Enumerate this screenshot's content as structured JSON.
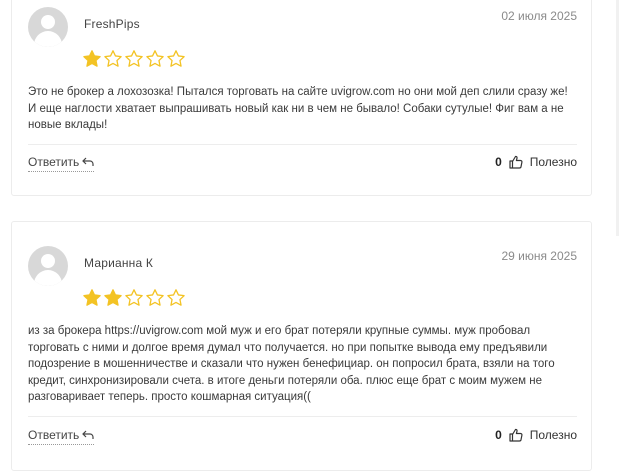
{
  "reviews": [
    {
      "author": "FreshPips",
      "date": "02 июля 2025",
      "rating": 1,
      "max_rating": 5,
      "text": "Это не брокер а лохозозка! Пытался торговать на сайте uvigrow.com но они мой деп слили сразу же! И еще наглости хватает выпрашивать новый как ни в чем не бывало! Собаки сутулые! Фиг вам а не новые вклады!",
      "reply_label": "Ответить",
      "useful_count": "0",
      "useful_label": "Полезно"
    },
    {
      "author": "Марианна К",
      "date": "29 июня 2025",
      "rating": 2,
      "max_rating": 5,
      "text": "из за брокера https://uvigrow.com мой муж и его брат потеряли крупные суммы. муж пробовал торговать с ними и долгое время думал что получается. но при попытке вывода ему предъявили подозрение в мошенничестве и сказали что нужен бенефициар. он попросил брата, взяли на того кредит, синхронизировали счета. в итоге деньги потеряли оба. плюс еще брат с моим мужем не разговаривает теперь. просто кошмарная ситуация((",
      "reply_label": "Ответить",
      "useful_count": "0",
      "useful_label": "Полезно"
    }
  ],
  "colors": {
    "star_filled": "#f3c324",
    "star_outline": "#f3c324",
    "avatar_bg": "#d8d8d8"
  },
  "icons": {
    "avatar": "user-placeholder-icon",
    "star": "star-icon",
    "reply": "reply-arrow-icon",
    "thumb": "thumbs-up-icon"
  }
}
